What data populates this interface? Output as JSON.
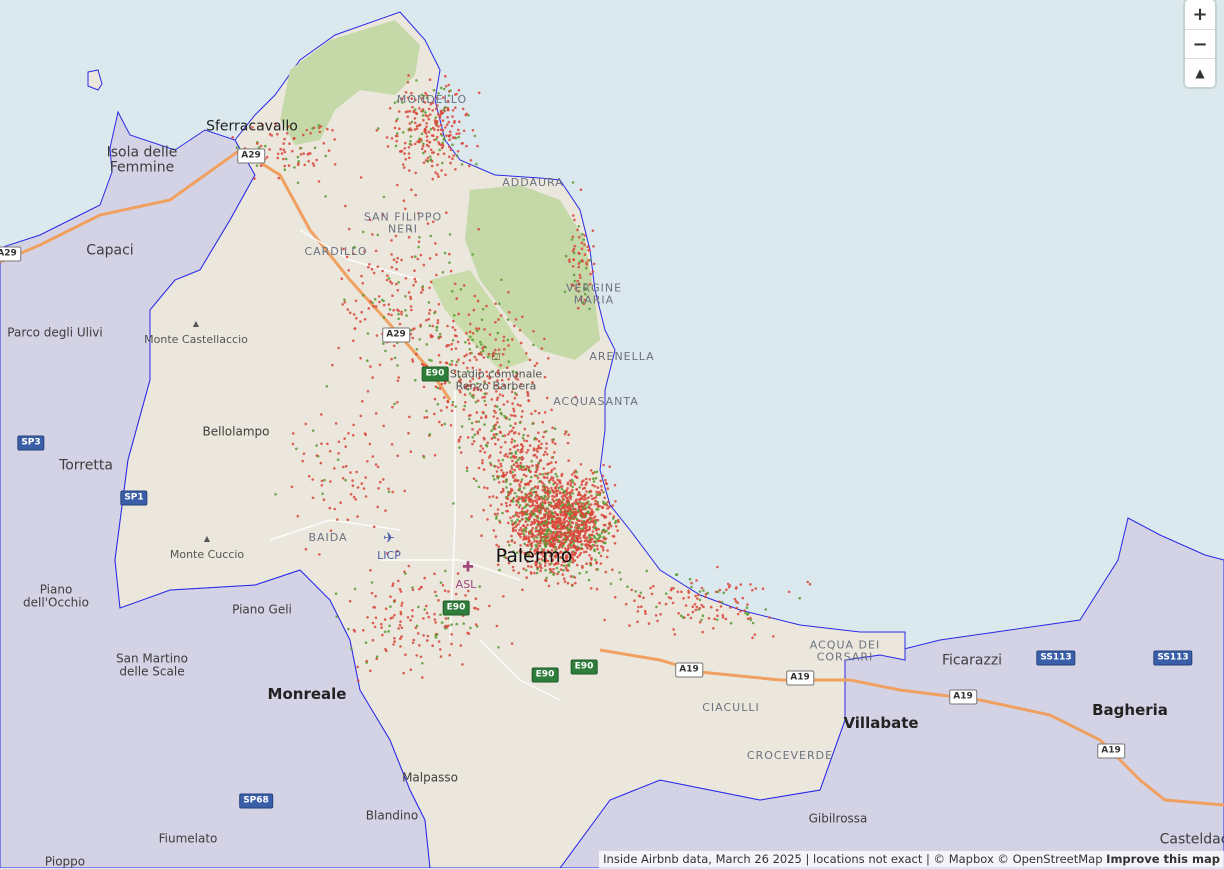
{
  "map": {
    "colors": {
      "sea": "#dbe9ee",
      "land": "#ebe7dd",
      "other_comune": "#d4d3e6",
      "park": "#c5d9a8",
      "boundary": "#2a2ae8",
      "motorway": "#f0a060",
      "dot_red": "#d9453a",
      "dot_green": "#5a9a32"
    },
    "places": {
      "sferracavallo": "Sferracavallo",
      "isola_delle_femmine": "Isola delle\nFemmine",
      "capaci": "Capaci",
      "parco_degli_ulivi": "Parco degli Ulivi",
      "monte_castellaccio": "Monte Castellaccio",
      "torretta": "Torretta",
      "bellolampo": "Bellolampo",
      "monte_cuccio": "Monte Cuccio",
      "piano_occhio": "Piano\ndell'Occhio",
      "piano_geli": "Piano Geli",
      "san_martino": "San Martino\ndelle Scale",
      "monreale": "Monreale",
      "malpasso": "Malpasso",
      "blandino": "Blandino",
      "fiumelato": "Fiumelato",
      "pioppo": "Pioppo",
      "palermo": "Palermo",
      "ficarazzi": "Ficarazzi",
      "villabate": "Villabate",
      "bagheria": "Bagheria",
      "gibilrossa": "Gibilrossa",
      "casteldaccia": "Casteldac"
    },
    "neighborhoods": {
      "mondello": "MONDELLO",
      "addaura": "ADDAURA",
      "san_filippo_neri": "SAN FILIPPO\nNERI",
      "cardillo": "CARDILLO",
      "vergine_maria": "VERGINE\nMARIA",
      "arenella": "ARENELLA",
      "acquasanta": "ACQUASANTA",
      "baida": "BAIDA",
      "acqua_dei_corsari": "ACQUA DEI\nCORSARI",
      "ciaculli": "CIACULLI",
      "croceverde": "CROCEVERDE"
    },
    "pois": {
      "stadio": "Stadio comunale\nRenzo Barbera",
      "licp": "LICP",
      "asl": "ASL"
    },
    "shields": {
      "a29_top": "A29",
      "a29_west": "A29",
      "a29_mid": "A29",
      "e90_a": "E90",
      "e90_b": "E90",
      "e90_c": "E90",
      "e90_d": "E90",
      "a19_a": "A19",
      "a19_b": "A19",
      "a19_c": "A19",
      "a19_d": "A19",
      "sp3": "SP3",
      "sp1": "SP1",
      "sp68": "SP68",
      "ss113_a": "SS113",
      "ss113_b": "SS113"
    },
    "icons": {
      "airport": "airport-icon",
      "stadium": "stadium-icon",
      "hospital": "hospital-icon",
      "peak": "peak-icon"
    }
  },
  "controls": {
    "zoom_in": "+",
    "zoom_out": "−",
    "reset_north": "▲"
  },
  "attribution": {
    "text": "Inside Airbnb data, March 26 2025 | locations not exact | © Mapbox © OpenStreetMap",
    "improve": "Improve this map"
  }
}
